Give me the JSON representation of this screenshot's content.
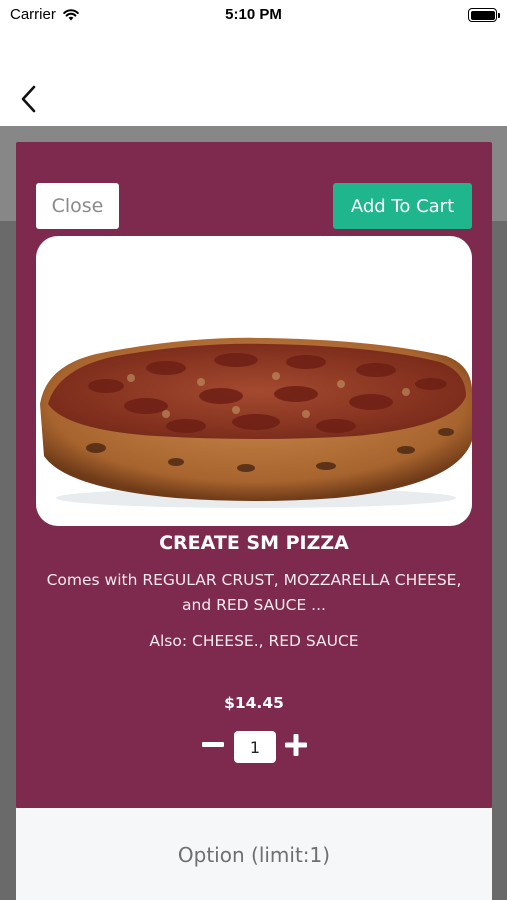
{
  "status_bar": {
    "carrier": "Carrier",
    "time": "5:10 PM",
    "icons": [
      "wifi-icon",
      "battery-icon"
    ]
  },
  "nav": {
    "back_icon": "chevron-left-icon"
  },
  "modal": {
    "background_color": "#7d2a4e",
    "close_label": "Close",
    "add_to_cart_label": "Add To Cart",
    "add_to_cart_color": "#1fb68e",
    "image_alt": "pizza photo",
    "title": "CREATE SM PIZZA",
    "description": "Comes with REGULAR CRUST, MOZZARELLA CHEESE, and RED SAUCE ...",
    "also": "Also: CHEESE., RED SAUCE",
    "price": "$14.45",
    "quantity": "1",
    "minus_icon": "minus-icon",
    "plus_icon": "plus-icon"
  },
  "options": {
    "label": "Option (limit:1)"
  }
}
